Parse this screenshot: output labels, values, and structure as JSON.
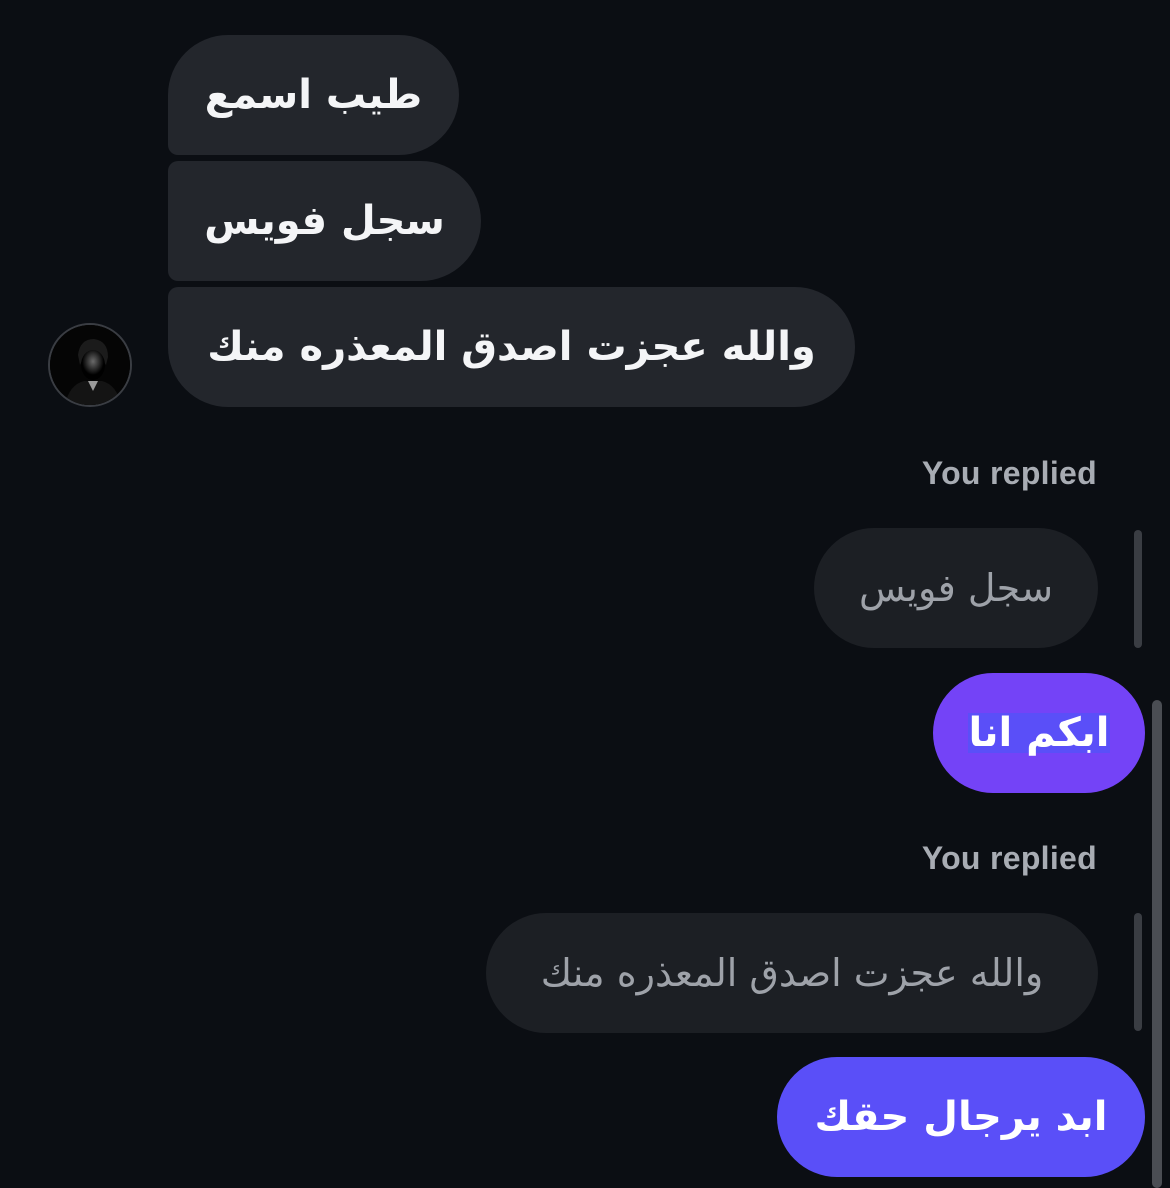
{
  "conversation": {
    "incoming": [
      {
        "text": "طيب اسمع"
      },
      {
        "text": "سجل فويس"
      },
      {
        "text": "والله عجزت اصدق المعذره منك"
      }
    ],
    "thread": [
      {
        "reply_label": "You replied",
        "quoted_text": "سجل فويس",
        "reply_text": "ابكم انا",
        "reply_color": "#7443f7"
      },
      {
        "reply_label": "You replied",
        "quoted_text": "والله عجزت اصدق المعذره منك",
        "reply_text": "ابد يرجال حقك",
        "reply_color": "#5a4ff8"
      }
    ]
  },
  "colors": {
    "background": "#0b0e13",
    "incoming_bubble": "#23262c",
    "quoted_bubble": "#1c1f24"
  },
  "icons": {
    "avatar": "contact-avatar-photo"
  }
}
